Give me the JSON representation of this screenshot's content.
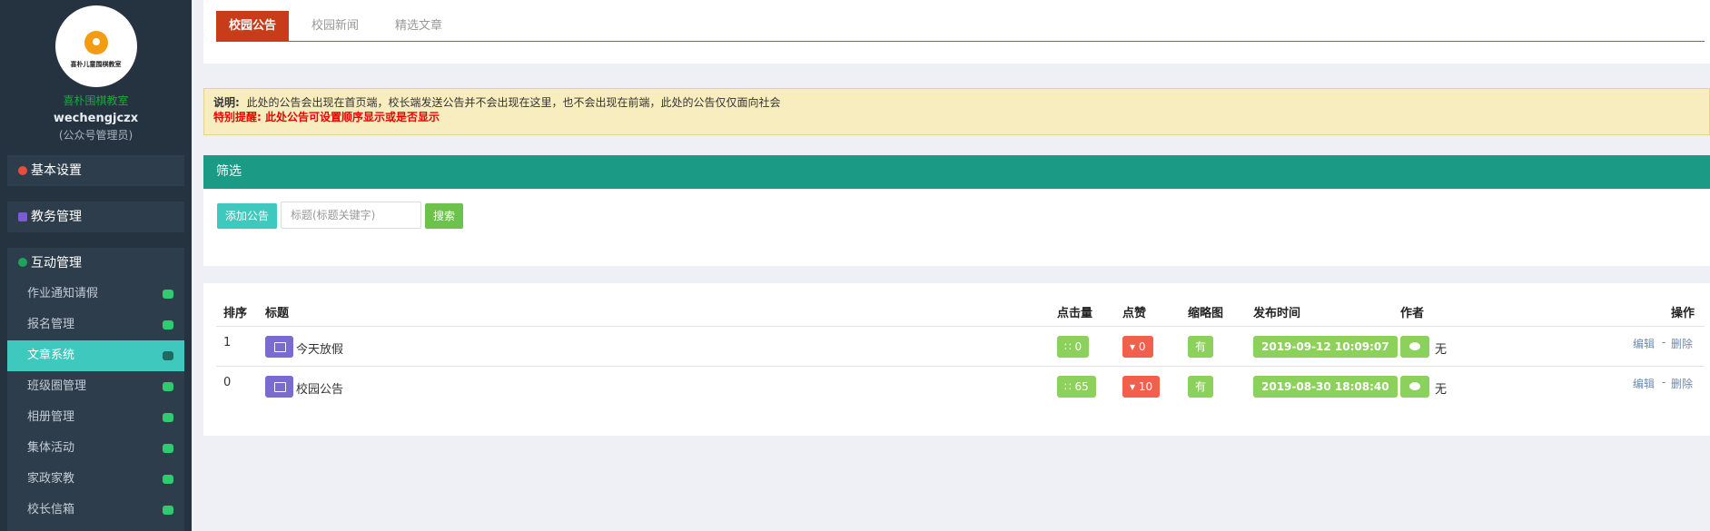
{
  "sidebar": {
    "logo_text": "喜朴儿童围棋教室",
    "org_name": "喜朴围棋教室",
    "user_id": "wechengjczx",
    "user_role": "(公众号管理员)",
    "groups": [
      {
        "label": "基本设置",
        "icon": "gear-icon"
      },
      {
        "label": "教务管理",
        "icon": "book-icon"
      },
      {
        "label": "互动管理",
        "icon": "chat-icon"
      }
    ],
    "items": [
      {
        "label": "作业通知请假",
        "icon": "megaphone-icon"
      },
      {
        "label": "报名管理",
        "icon": "chat-icon"
      },
      {
        "label": "文章系统",
        "icon": "monitor-icon"
      },
      {
        "label": "班级圈管理",
        "icon": "chat-icon"
      },
      {
        "label": "相册管理",
        "icon": "camera-icon"
      },
      {
        "label": "集体活动",
        "icon": "trophy-icon"
      },
      {
        "label": "家政家教",
        "icon": "cup-icon"
      },
      {
        "label": "校长信箱",
        "icon": "chat-icon"
      }
    ]
  },
  "tabs": [
    "校园公告",
    "校园新闻",
    "精选文章"
  ],
  "notice": {
    "label": "说明:",
    "text": "此处的公告会出现在首页端，校长端发送公告并不会出现在这里，也不会出现在前端，此处的公告仅仅面向社会",
    "warning": "特别提醒: 此处公告可设置顺序显示或是否显示"
  },
  "filter": {
    "title": "筛选",
    "add_label": "添加公告",
    "search_placeholder": "标题(标题关键字)",
    "search_label": "搜索"
  },
  "table": {
    "headers": [
      "排序",
      "标题",
      "点击量",
      "点赞",
      "缩略图",
      "发布时间",
      "作者",
      "操作"
    ],
    "rows": [
      {
        "order": "1",
        "title": "今天放假",
        "clicks": "0",
        "likes": "0",
        "thumb": "有",
        "date": "2019-09-12 10:09:07",
        "author": "无",
        "edit": "编辑",
        "sep": "-",
        "del": "删除"
      },
      {
        "order": "0",
        "title": "校园公告",
        "clicks": "65",
        "likes": "10",
        "thumb": "有",
        "date": "2019-08-30 18:08:40",
        "author": "无",
        "edit": "编辑",
        "sep": "-",
        "del": "删除"
      }
    ]
  },
  "colors": {
    "sidebar_bg": "#253240",
    "active_item": "#3fc9be",
    "tab_active": "#c73d1a",
    "filter_head": "#1b9a86",
    "badge_green": "#8cd15c",
    "badge_red": "#f0604d"
  }
}
